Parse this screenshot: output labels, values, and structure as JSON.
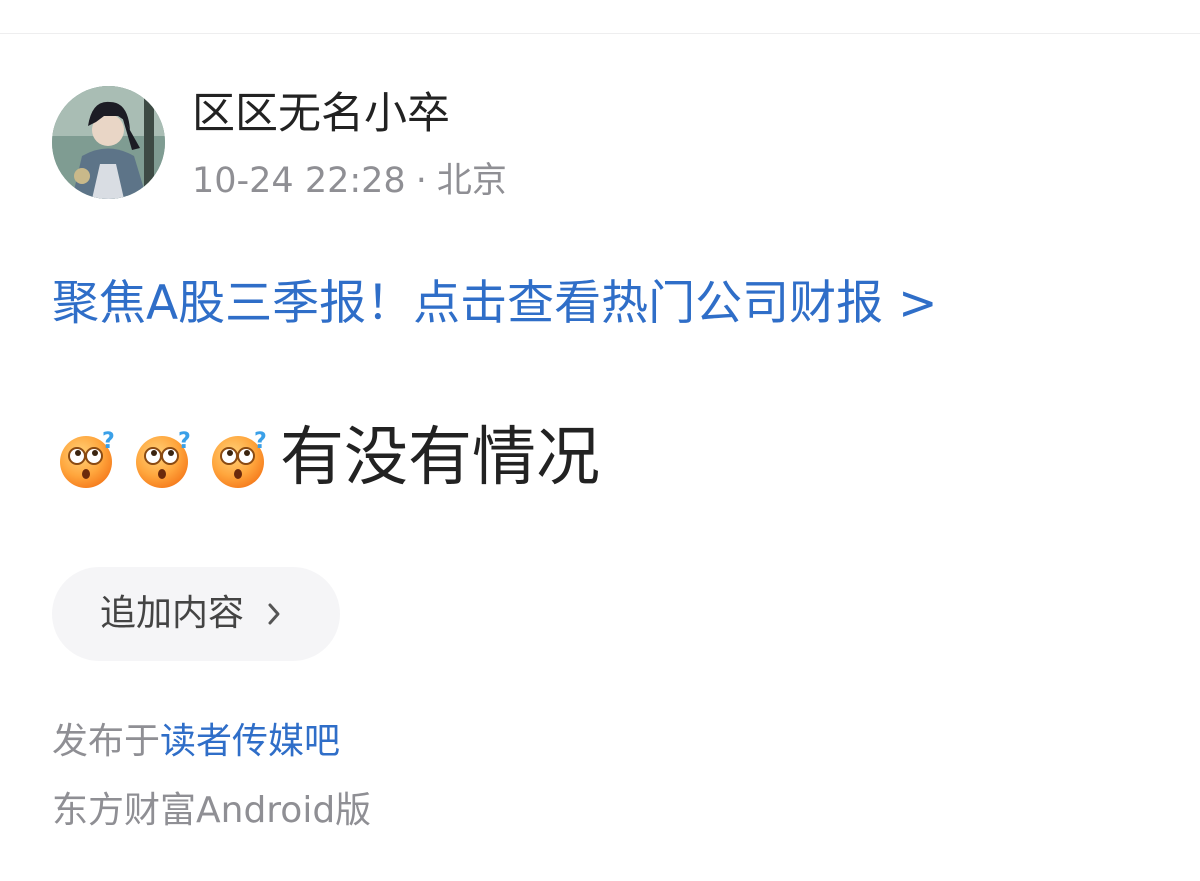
{
  "post": {
    "author": {
      "name": "区区无名小卒",
      "avatar_icon": "avatar-image"
    },
    "meta": {
      "time": "10-24 22:28",
      "separator": "·",
      "location": "北京"
    },
    "promo_link": "聚焦A股三季报！点击查看热门公司财报 >",
    "body": {
      "emojis": [
        "thinking-emoji",
        "thinking-emoji",
        "thinking-emoji"
      ],
      "text": "有没有情况"
    },
    "append_button": {
      "label": "追加内容",
      "icon": "chevron-right-icon"
    },
    "posted_in": {
      "prefix": "发布于",
      "bar_name": "读者传媒吧"
    },
    "client": "东方财富Android版"
  },
  "colors": {
    "link": "#2f6ec8",
    "text": "#222222",
    "muted": "#8f8f94",
    "button_bg": "#f5f5f7"
  }
}
